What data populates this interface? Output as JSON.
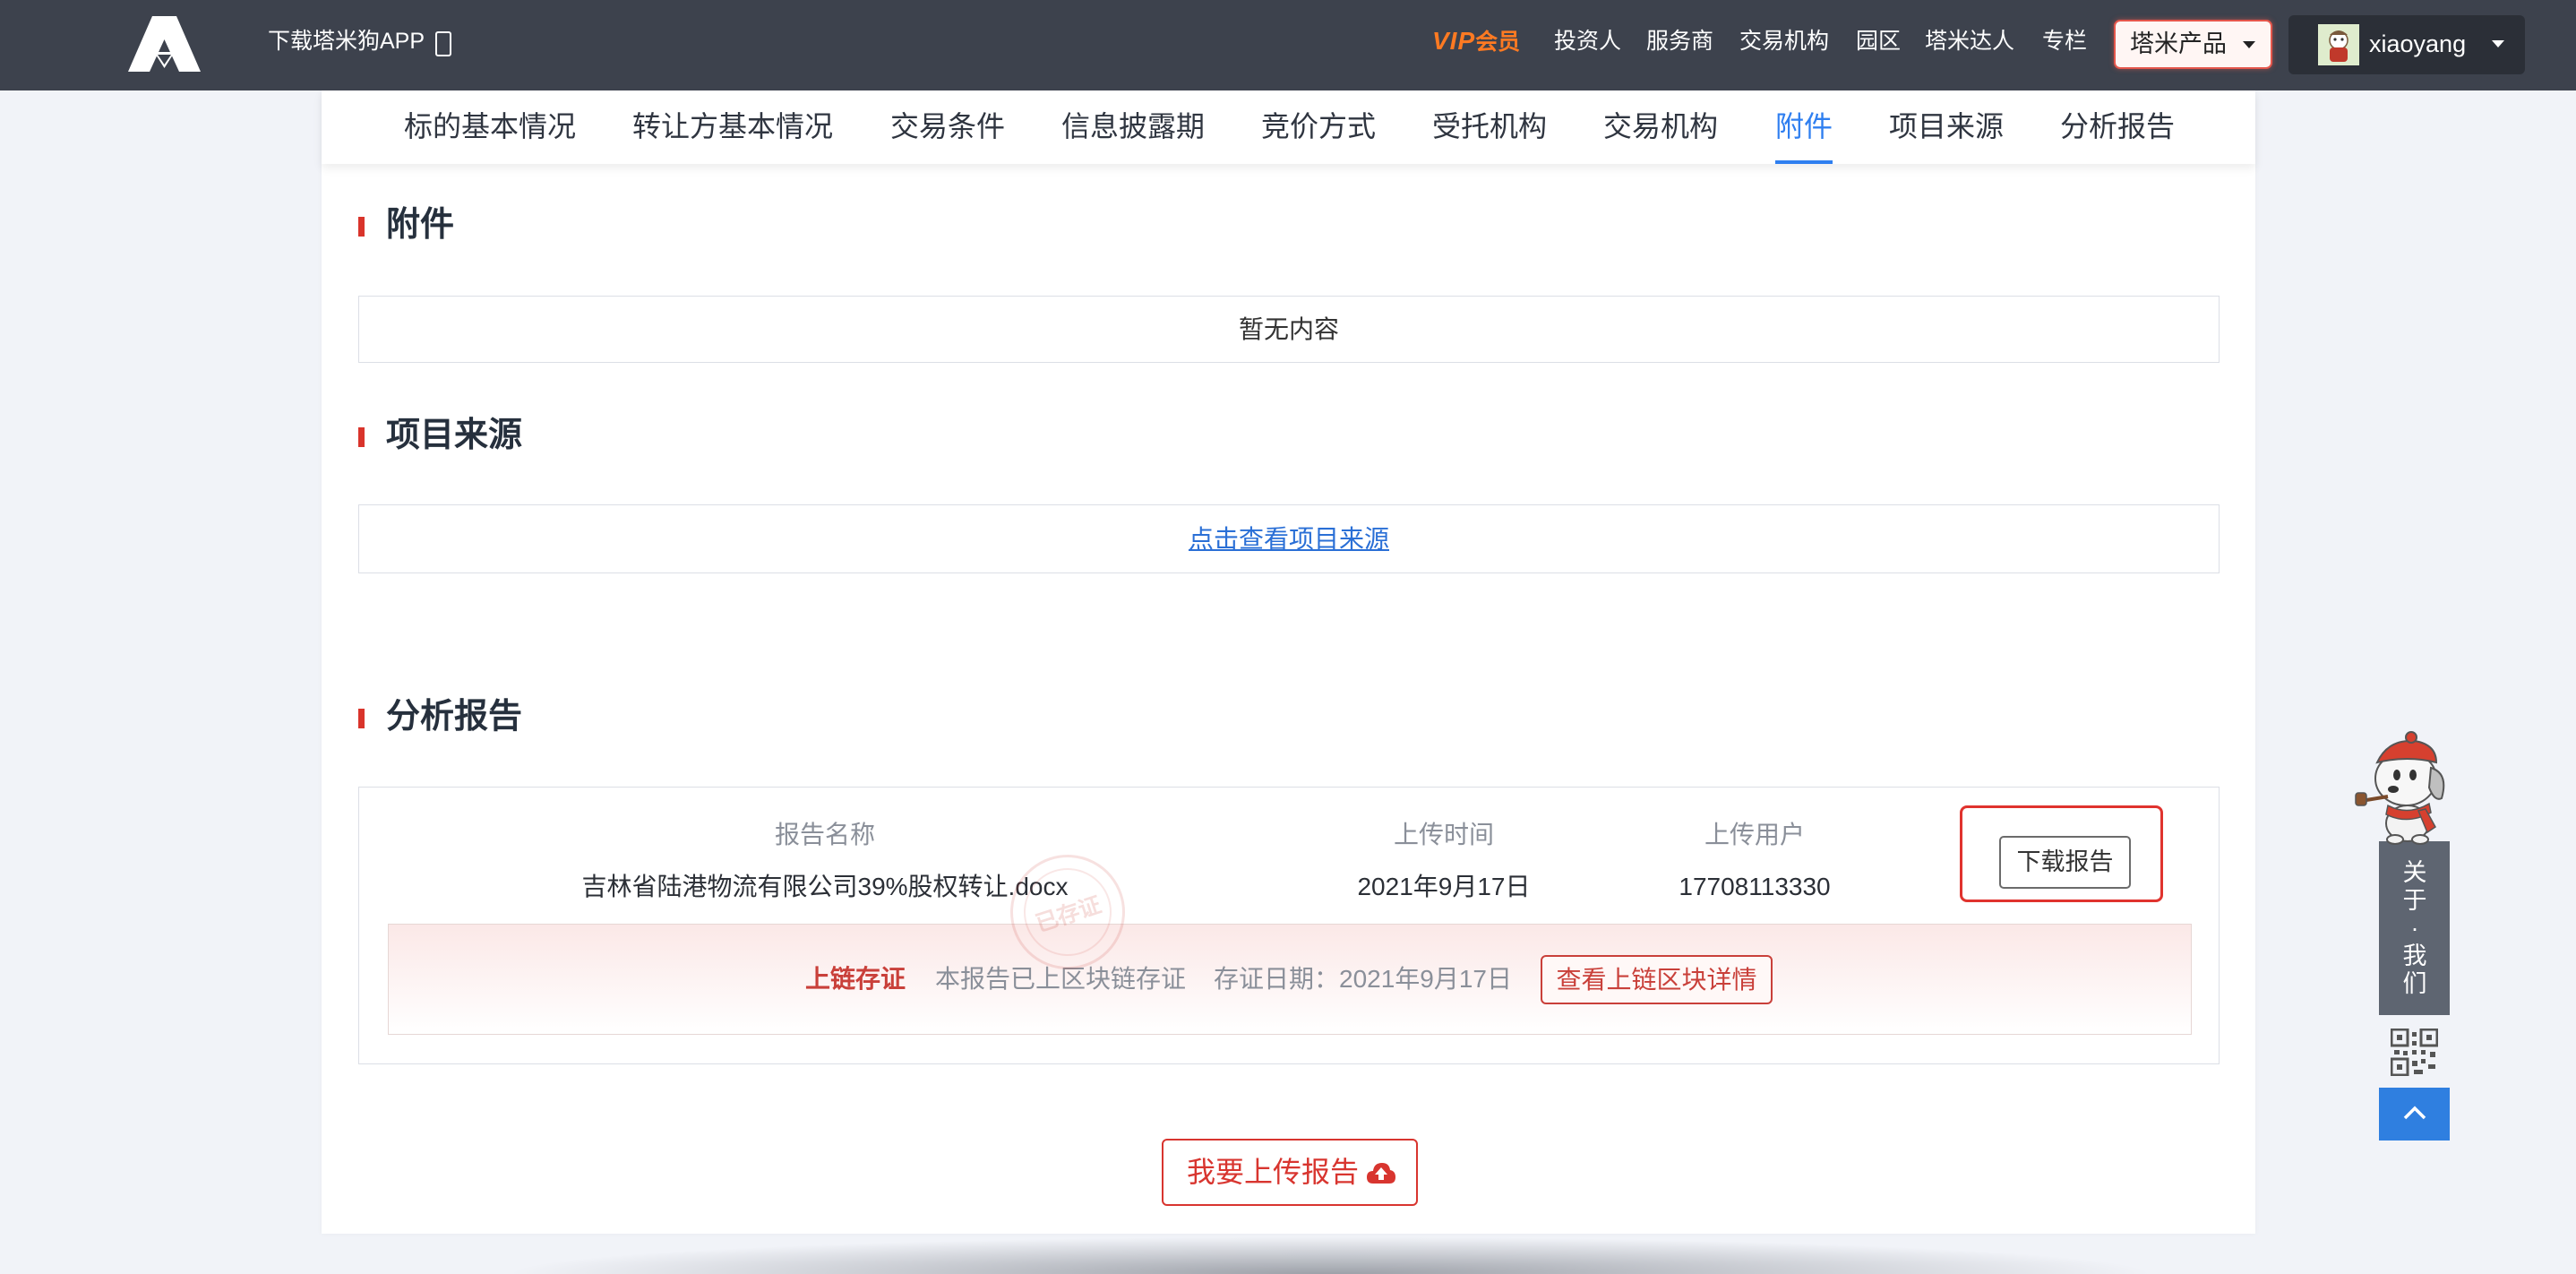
{
  "navbar": {
    "app_download": "下载塔米狗APP",
    "vip_prefix": "VIP",
    "vip_label": "会员",
    "links": [
      "投资人",
      "服务商",
      "交易机构",
      "园区",
      "塔米达人",
      "专栏"
    ],
    "products_label": "塔米产品",
    "username": "xiaoyang"
  },
  "tabs": {
    "items": [
      "标的基本情况",
      "转让方基本情况",
      "交易条件",
      "信息披露期",
      "竞价方式",
      "受托机构",
      "交易机构",
      "附件",
      "项目来源",
      "分析报告"
    ],
    "active_index": 7
  },
  "sections": {
    "attachments": {
      "title": "附件",
      "empty_text": "暂无内容"
    },
    "source": {
      "title": "项目来源",
      "link_text": "点击查看项目来源"
    },
    "report": {
      "title": "分析报告"
    }
  },
  "report": {
    "headers": {
      "name": "报告名称",
      "time": "上传时间",
      "user": "上传用户"
    },
    "row": {
      "name": "吉林省陆港物流有限公司39%股权转让.docx",
      "time": "2021年9月17日",
      "user": "17708113330"
    },
    "download_label": "下载报告",
    "stamp_text": "已存证",
    "blockchain": {
      "title": "上链存证",
      "desc": "本报告已上区块链存证",
      "date_label": "存证日期：2021年9月17日",
      "detail_button": "查看上链区块详情"
    },
    "upload_button": "我要上传报告"
  },
  "float_widget": {
    "about_label": "关于·我们"
  },
  "colors": {
    "navbar_bg": "#3d424d",
    "vip": "#ff7a22",
    "active_tab": "#2f7ff0",
    "accent_red": "#d9342b",
    "link_blue": "#2a6fd6",
    "back_to_top": "#2f7fe0"
  },
  "icons": {
    "logo": "tamigou-logo-icon",
    "app": "phone-icon",
    "dropdown": "caret-down-icon",
    "upload": "cloud-upload-icon",
    "qr": "qr-code-icon",
    "top": "chevron-up-icon"
  }
}
